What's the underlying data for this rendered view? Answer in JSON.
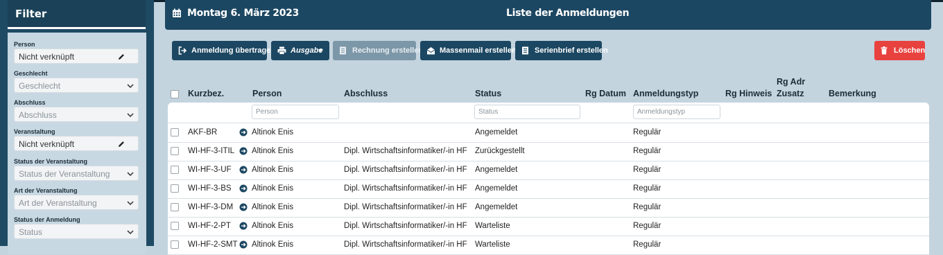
{
  "sidebar": {
    "title": "Filter",
    "filters": [
      {
        "label": "Person",
        "value": "Nicht verknüpft",
        "kind": "fixed",
        "icon": "pencil-icon"
      },
      {
        "label": "Geschlecht",
        "value": "Geschlecht",
        "kind": "select"
      },
      {
        "label": "Abschluss",
        "value": "Abschluss",
        "kind": "select"
      },
      {
        "label": "Veranstaltung",
        "value": "Nicht verknüpft",
        "kind": "fixed",
        "icon": "pencil-icon"
      },
      {
        "label": "Status der Veranstaltung",
        "value": "Status der Veranstaltung",
        "kind": "select"
      },
      {
        "label": "Art der Veranstaltung",
        "value": "Art der Veranstaltung",
        "kind": "select"
      },
      {
        "label": "Status der Anmeldung",
        "value": "Status",
        "kind": "select"
      }
    ]
  },
  "header": {
    "date": "Montag 6. März 2023",
    "title": "Liste der Anmeldungen",
    "icon": "calendar-icon"
  },
  "toolbar": {
    "transfer": "Anmeldung übertragen",
    "output": "Ausgabe",
    "invoice": "Rechnung erstellen",
    "massmail": "Massenmail erstellen",
    "serial": "Serienbrief erstellen",
    "delete": "Löschen"
  },
  "table": {
    "columns": {
      "kurzbez": "Kurzbez.",
      "person": "Person",
      "abschluss": "Abschluss",
      "status": "Status",
      "rg_datum": "Rg Datum",
      "anmeldungstyp": "Anmeldungstyp",
      "rg_hinweis": "Rg Hinweis",
      "rg_adr_zusatz_1": "Rg Adr",
      "rg_adr_zusatz_2": "Zusatz",
      "bemerkung": "Bemerkung"
    },
    "filters": {
      "person": "Person",
      "status": "Status",
      "anmeldungstyp": "Anmeldungstyp"
    },
    "rows": [
      {
        "kurzbez": "AKF-BR",
        "person": "Altinok Enis",
        "abschluss": "",
        "status": "Angemeldet",
        "typ": "Regulär"
      },
      {
        "kurzbez": "WI-HF-3-ITIL",
        "person": "Altinok Enis",
        "abschluss": "Dipl. Wirtschaftsinformatiker/-in HF",
        "status": "Zurückgestellt",
        "typ": "Regulär"
      },
      {
        "kurzbez": "WI-HF-3-UF",
        "person": "Altinok Enis",
        "abschluss": "Dipl. Wirtschaftsinformatiker/-in HF",
        "status": "Angemeldet",
        "typ": "Regulär"
      },
      {
        "kurzbez": "WI-HF-3-BS",
        "person": "Altinok Enis",
        "abschluss": "Dipl. Wirtschaftsinformatiker/-in HF",
        "status": "Angemeldet",
        "typ": "Regulär"
      },
      {
        "kurzbez": "WI-HF-3-DM",
        "person": "Altinok Enis",
        "abschluss": "Dipl. Wirtschaftsinformatiker/-in HF",
        "status": "Angemeldet",
        "typ": "Regulär"
      },
      {
        "kurzbez": "WI-HF-2-PT",
        "person": "Altinok Enis",
        "abschluss": "Dipl. Wirtschaftsinformatiker/-in HF",
        "status": "Warteliste",
        "typ": "Regulär"
      },
      {
        "kurzbez": "WI-HF-2-SMT",
        "person": "Altinok Enis",
        "abschluss": "Dipl. Wirtschaftsinformatiker/-in HF",
        "status": "Warteliste",
        "typ": "Regulär"
      }
    ]
  },
  "colors": {
    "navy": "#1c4762",
    "panel": "#c3d4df",
    "danger": "#e8423f",
    "disabled": "#7c97a8"
  }
}
